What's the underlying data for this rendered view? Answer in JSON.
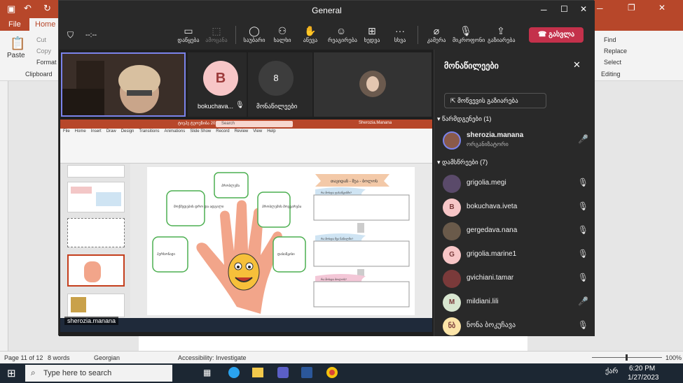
{
  "ppt": {
    "tabs": [
      "File",
      "Home"
    ],
    "clipboard": {
      "paste": "Paste",
      "cut": "Cut",
      "copy": "Copy",
      "format": "Format P",
      "group": "Clipboard"
    },
    "editing": {
      "find": "Find",
      "replace": "Replace",
      "select": "Select",
      "group": "Editing"
    },
    "status": {
      "page": "Page 11 of 12",
      "words": "8 words",
      "language": "Georgian",
      "accessibility": "Accessibility: Investigate",
      "zoom": "100%"
    }
  },
  "taskbar": {
    "search_placeholder": "Type here to search",
    "time": "6:20 PM",
    "date": "1/27/2023",
    "lang": "ქარ"
  },
  "teams": {
    "title": "General",
    "timer": "--:--",
    "toolbar": [
      "დაწყება",
      "ამოცანა",
      "საუბარი",
      "ხალხი",
      "აწევა",
      "რეაგირება",
      "ხედვა",
      "სხვა",
      "კამერა",
      "მიკროფონი",
      "გაზიარება"
    ],
    "leave": "გასვლა",
    "tiles": {
      "b_initial": "B",
      "b_name": "bokuchava...",
      "count": "8",
      "count_label": "მონაწილეები"
    },
    "presenter": "sherozia.manana",
    "panel": {
      "title": "მონაწილეები",
      "share_invite": "მოწვევის გაზიარება",
      "presenters_header": "წარმდგენები (1)",
      "organizer_name": "sherozia.manana",
      "organizer_role": "ორგანიზატორი",
      "attendees_header": "დამსწრეები (7)",
      "attendees": [
        {
          "name": "grigolia.megi",
          "initial": "",
          "color": "#5a4a6a",
          "mic": "muted"
        },
        {
          "name": "bokuchava.iveta",
          "initial": "B",
          "color": "#f7c6c7",
          "mic": "muted"
        },
        {
          "name": "gergedava.nana",
          "initial": "",
          "color": "#6a5a4a",
          "mic": "muted"
        },
        {
          "name": "grigolia.marine1",
          "initial": "G",
          "color": "#f7c6c7",
          "mic": "muted"
        },
        {
          "name": "gvichiani.tamar",
          "initial": "",
          "color": "#7a3a3a",
          "mic": "muted"
        },
        {
          "name": "mildiani.lili",
          "initial": "M",
          "color": "#d8e6d0",
          "mic": "on"
        },
        {
          "name": "ნონა ბოკუჩავა",
          "initial": "ნბ",
          "color": "#fbe4a8",
          "mic": "muted"
        }
      ]
    },
    "slide": {
      "title_bar": "ტიეჰე ტუოუზიბა 2023 (8) - Copy - PowerPoint",
      "search": "Search",
      "user": "Sherozia.Manana",
      "menu": [
        "File",
        "Home",
        "Insert",
        "Draw",
        "Design",
        "Transitions",
        "Animations",
        "Slide Show",
        "Record",
        "Review",
        "View",
        "Help"
      ],
      "fingers": [
        "მოქმედების დრო და ადგილი",
        "პრობლემა",
        "პრობლემის მოგვარება",
        "პერსონაჟი",
        "დასაწყისი"
      ],
      "heading": "თავიდან - შუა - ბოლოს",
      "questions": [
        "რა მოხდა დასაწყისში?",
        "რა მოხდა შუა ნაწილში?",
        "რა მოხდა ბოლოს?"
      ],
      "thumbs": [
        "11",
        "12",
        "13",
        "14",
        "15"
      ]
    }
  }
}
